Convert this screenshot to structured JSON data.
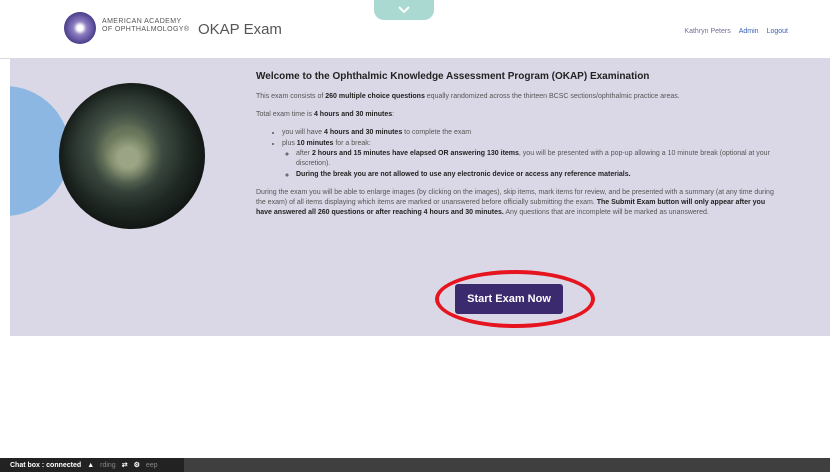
{
  "header": {
    "logo_line1": "AMERICAN ACADEMY",
    "logo_line2": "OF OPHTHALMOLOGY®",
    "app_title": "OKAP Exam",
    "user_name": "Kathryn Peters",
    "admin_link": "Admin",
    "logout_link": "Logout",
    "pulltab_icon": "chevron-down-icon"
  },
  "welcome": {
    "heading": "Welcome to the Ophthalmic Knowledge Assessment Program (OKAP) Examination",
    "intro_a": "This exam consists of ",
    "intro_count": "260 multiple choice questions",
    "intro_b": " equally randomized across the thirteen BCSC sections/ophthalmic practice areas.",
    "time_a": "Total exam time is ",
    "time_total": "4 hours and 30 minutes",
    "time_b": ":",
    "bullet1_a": "you will have ",
    "bullet1_b": "4 hours and 30 minutes",
    "bullet1_c": " to complete the exam",
    "bullet2_a": "plus ",
    "bullet2_b": "10 minutes",
    "bullet2_c": " for a break:",
    "sub1_a": "after ",
    "sub1_b": "2 hours and 15 minutes have elapsed OR answering 130 items",
    "sub1_c": ", you will be presented with a pop-up allowing a 10 minute break (optional at your discretion).",
    "sub2": "During the break you are not allowed to use any electronic device or access any reference materials.",
    "during_a": "During the exam you will be able to enlarge images (by clicking on the images), skip items, mark items for review, and be presented with a summary (at any time during the exam) of all items displaying which items are marked or unanswered before officially submitting the exam. ",
    "during_b": "The Submit Exam button will only appear after you have answered all 260 questions or after reaching 4 hours and 30 minutes.",
    "during_c": " Any questions that are incomplete will be marked as unanswered."
  },
  "actions": {
    "start_label": "Start Exam Now"
  },
  "footer": {
    "chat_label": "Chat box : connected",
    "chat_faint": "rding",
    "chat_faint2": "eep"
  },
  "colors": {
    "panel": "#dad8e6",
    "button": "#3b2a6e",
    "highlight": "#e6141f",
    "pulltab": "#a9d9d0"
  }
}
